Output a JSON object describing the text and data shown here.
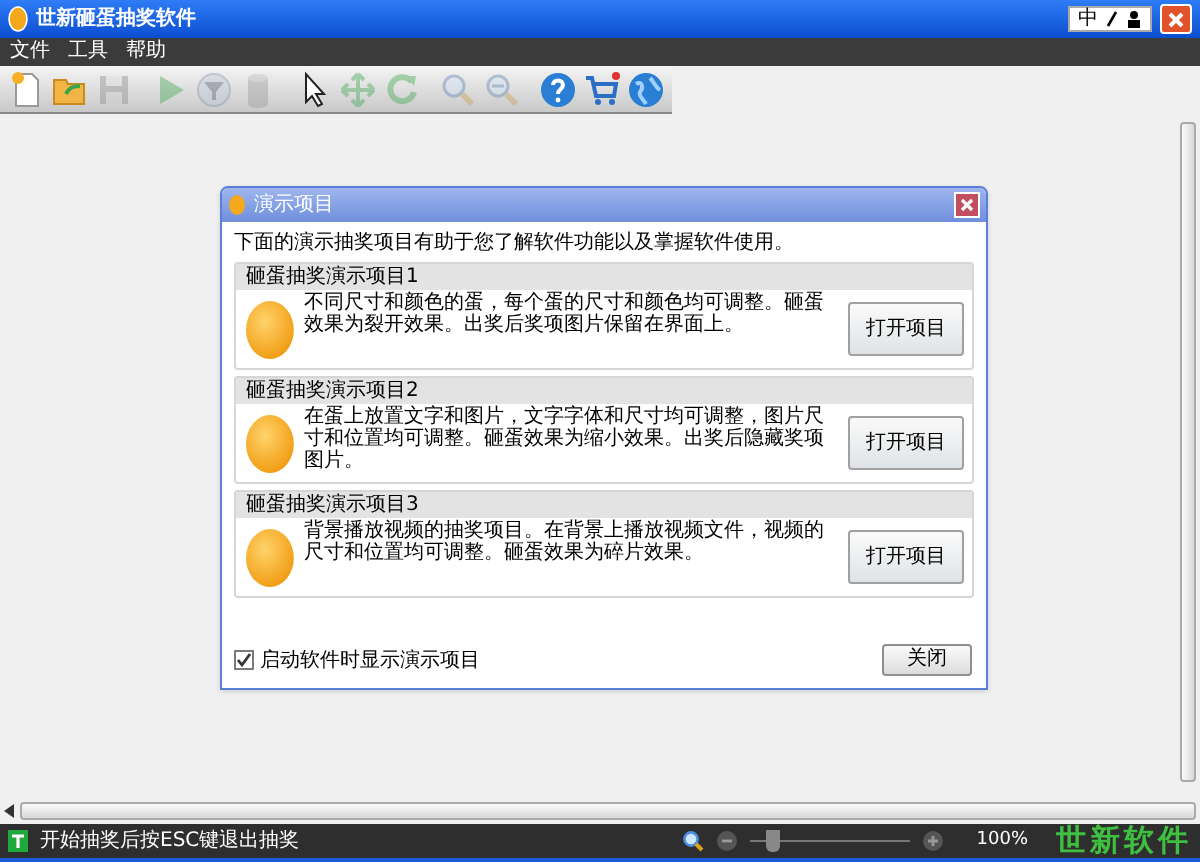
{
  "window": {
    "title": "世新砸蛋抽奖软件",
    "ime_label": "中"
  },
  "menu": [
    "文件",
    "工具",
    "帮助"
  ],
  "toolbar": [
    {
      "kind": "new",
      "disabled": false
    },
    {
      "kind": "open",
      "disabled": false
    },
    {
      "kind": "save",
      "disabled": true
    },
    {
      "kind": "separator"
    },
    {
      "kind": "play",
      "disabled": true
    },
    {
      "kind": "filter",
      "disabled": true
    },
    {
      "kind": "database",
      "disabled": true
    },
    {
      "kind": "separator"
    },
    {
      "kind": "pointer",
      "disabled": false
    },
    {
      "kind": "move",
      "disabled": true
    },
    {
      "kind": "rotate",
      "disabled": true
    },
    {
      "kind": "separator"
    },
    {
      "kind": "zoom_in",
      "disabled": true
    },
    {
      "kind": "zoom_out",
      "disabled": true
    },
    {
      "kind": "separator"
    },
    {
      "kind": "help",
      "disabled": false
    },
    {
      "kind": "cart",
      "disabled": false
    },
    {
      "kind": "globe",
      "disabled": false
    }
  ],
  "dialog": {
    "title": "演示项目",
    "intro": "下面的演示抽奖项目有助于您了解软件功能以及掌握软件使用。",
    "projects": [
      {
        "title": "砸蛋抽奖演示项目1",
        "description": "不同尺寸和颜色的蛋，每个蛋的尺寸和颜色均可调整。砸蛋效果为裂开效果。出奖后奖项图片保留在界面上。",
        "button": "打开项目"
      },
      {
        "title": "砸蛋抽奖演示项目2",
        "description": "在蛋上放置文字和图片，文字字体和尺寸均可调整，图片尺寸和位置均可调整。砸蛋效果为缩小效果。出奖后隐藏奖项图片。",
        "button": "打开项目"
      },
      {
        "title": "砸蛋抽奖演示项目3",
        "description": "背景播放视频的抽奖项目。在背景上播放视频文件，视频的尺寸和位置均可调整。砸蛋效果为碎片效果。",
        "button": "打开项目"
      }
    ],
    "show_on_startup": {
      "label": "启动软件时显示演示项目",
      "checked": true
    },
    "close_button": "关闭"
  },
  "status_bar": {
    "message": "开始抽奖后按ESC键退出抽奖",
    "zoom": {
      "level": 0.1,
      "reading": "100%"
    },
    "logo": "世新软件"
  }
}
